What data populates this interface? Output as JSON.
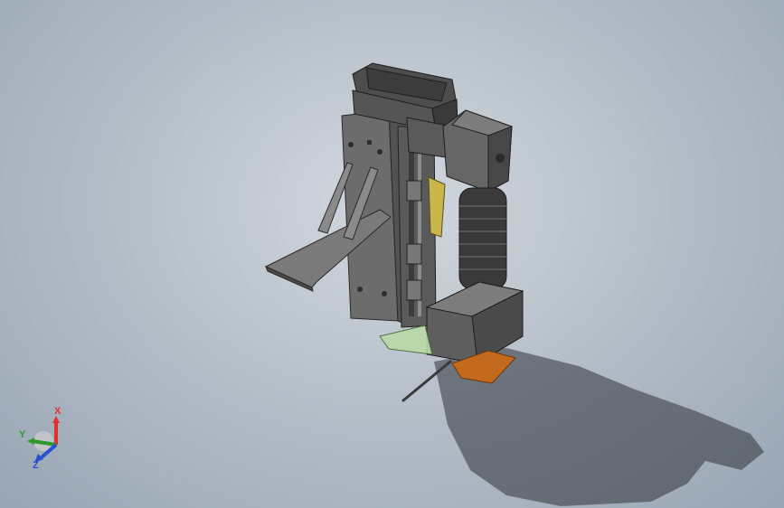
{
  "viewport": {
    "background_top": "#d2d8de",
    "background_bottom": "#98a5b3"
  },
  "model": {
    "body_color": "#6e6e6e",
    "dark_color": "#3a3a3a",
    "highlight_color": "#b9d9a8",
    "accent_yellow": "#c8b64a",
    "accent_orange": "#c46a1e"
  },
  "triad": {
    "x_label": "X",
    "y_label": "Y",
    "z_label": "Z",
    "x_color": "#e03030",
    "y_color": "#2e9a2e",
    "z_color": "#2a4fd0"
  }
}
